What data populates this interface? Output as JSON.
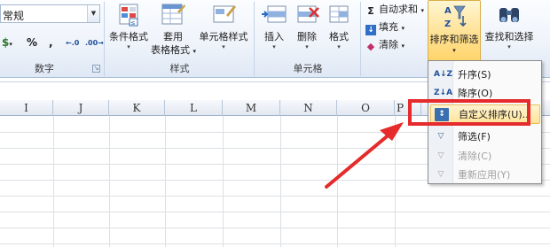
{
  "ribbon": {
    "number_format": {
      "value": "常规",
      "symbols": [
        "$",
        "%",
        ",",
        "←.0",
        ".00→"
      ]
    },
    "groups": {
      "number": "数字",
      "styles": "样式",
      "cells": "单元格"
    },
    "buttons": {
      "conditional_format": "条件格式",
      "format_as_table_l1": "套用",
      "format_as_table_l2": "表格格式",
      "cell_styles": "单元格样式",
      "insert": "插入",
      "delete": "删除",
      "format": "格式",
      "autosum": "自动求和",
      "fill": "填充",
      "clear": "清除",
      "sort_filter": "排序和筛选",
      "find_select": "查找和选择"
    }
  },
  "columns": [
    "I",
    "J",
    "K",
    "L",
    "M",
    "N",
    "O",
    "P"
  ],
  "sort_menu": {
    "items": [
      {
        "label": "升序(S)",
        "icon": "A↓Z",
        "disabled": false
      },
      {
        "label": "降序(O)",
        "icon": "Z↓A",
        "disabled": false
      },
      {
        "label": "自定义排序(U)...",
        "icon": "↕",
        "disabled": false,
        "highlighted": true
      },
      {
        "label": "筛选(F)",
        "icon": "▽",
        "disabled": false
      },
      {
        "label": "清除(C)",
        "icon": "▽",
        "disabled": true
      },
      {
        "label": "重新应用(Y)",
        "icon": "▽",
        "disabled": true
      }
    ]
  },
  "colors": {
    "annotation": "#e52b2b",
    "hover": "#ffe39a",
    "ribbon": "#dfe8f5"
  }
}
